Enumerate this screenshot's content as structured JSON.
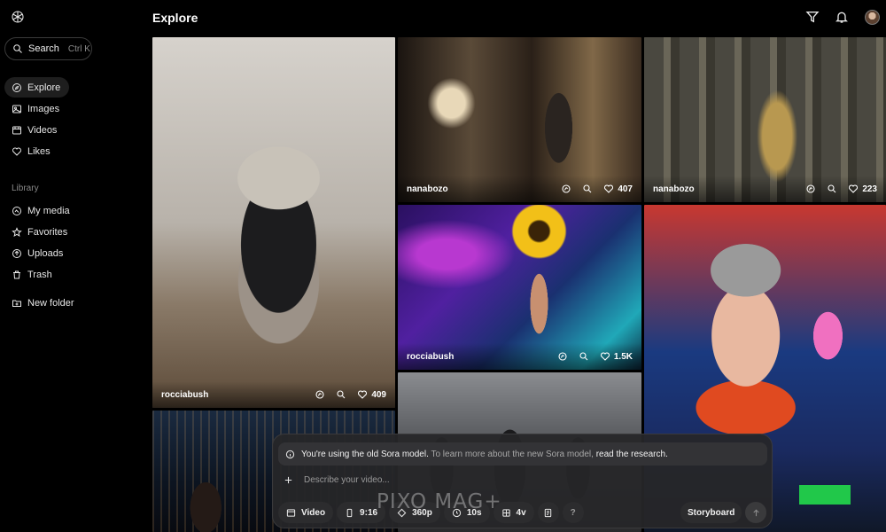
{
  "header": {
    "title": "Explore"
  },
  "search": {
    "label": "Search",
    "shortcut": "Ctrl K"
  },
  "nav": {
    "main": [
      {
        "label": "Explore",
        "icon": "compass-icon",
        "active": true
      },
      {
        "label": "Images",
        "icon": "image-icon"
      },
      {
        "label": "Videos",
        "icon": "video-icon"
      },
      {
        "label": "Likes",
        "icon": "heart-icon"
      }
    ],
    "library_label": "Library",
    "library": [
      {
        "label": "My media",
        "icon": "media-icon"
      },
      {
        "label": "Favorites",
        "icon": "star-icon"
      },
      {
        "label": "Uploads",
        "icon": "upload-icon"
      },
      {
        "label": "Trash",
        "icon": "trash-icon"
      }
    ],
    "new_folder": {
      "label": "New folder",
      "icon": "folder-plus-icon"
    }
  },
  "feed": [
    {
      "user": "rocciabush",
      "likes": "409",
      "subject": "cat in tuxedo"
    },
    {
      "user": "nanabozo",
      "likes": "407",
      "subject": "dancer in hall"
    },
    {
      "user": "nanabozo",
      "likes": "223",
      "subject": "golden queen in temple"
    },
    {
      "user": "rocciabush",
      "likes": "1.5K",
      "subject": "sunflower-head dancer"
    },
    {
      "user": "",
      "likes": "",
      "subject": "girl with headphones"
    },
    {
      "user": "",
      "likes": "",
      "subject": "dark horned figures"
    },
    {
      "user": "",
      "likes": "",
      "subject": "woman at desk night city"
    }
  ],
  "composer": {
    "notice_bold": "You're using the old Sora model.",
    "notice_text": "To learn more about the new Sora model,",
    "notice_link": "read the research.",
    "placeholder": "Describe your video...",
    "type": "Video",
    "aspect": "9:16",
    "resolution": "360p",
    "duration": "10s",
    "variations": "4v",
    "help": "?",
    "storyboard": "Storyboard"
  },
  "watermark": "PIXO MAG+",
  "colors": {
    "accent_green": "#21c84a",
    "panel": "#262628",
    "bg": "#000000"
  }
}
